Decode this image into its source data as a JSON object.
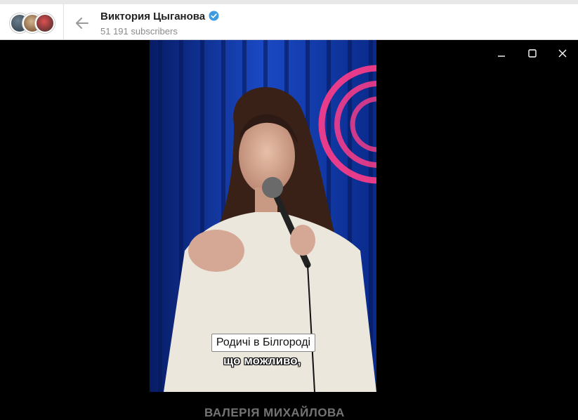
{
  "header": {
    "channel_title": "Виктория Цыганова",
    "subscribers": "51 191 subscribers"
  },
  "video": {
    "subtitle_box": "Родичі в Білгороді",
    "subtitle_outline": "що можливо,",
    "watermark": "ВАЛЕРІЯ МИХАЙЛОВА"
  },
  "colors": {
    "accent_verified": "#3f9ae0",
    "curtain": "#0a2a8a",
    "neon": "#ff3d8a"
  },
  "icons": {
    "back": "arrow-left-icon",
    "verified": "verified-badge-icon",
    "minimize": "minimize-icon",
    "maximize": "maximize-icon",
    "close": "close-icon"
  }
}
